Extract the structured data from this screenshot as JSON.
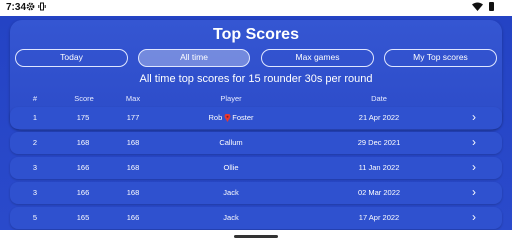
{
  "status": {
    "time": "7:34"
  },
  "title": "Top Scores",
  "tabs": [
    {
      "label": "Today",
      "active": false
    },
    {
      "label": "All time",
      "active": true
    },
    {
      "label": "Max games",
      "active": false
    },
    {
      "label": "My Top scores",
      "active": false
    }
  ],
  "subtitle": "All time top scores for 15 rounder 30s per round",
  "columns": {
    "rank": "#",
    "score": "Score",
    "max": "Max",
    "player": "Player",
    "date": "Date"
  },
  "rows": [
    {
      "rank": "1",
      "score": "175",
      "max": "177",
      "player_first": "Rob",
      "player_last": "Foster",
      "date": "21 Apr 2022"
    },
    {
      "rank": "2",
      "score": "168",
      "max": "168",
      "player": "Callum",
      "date": "29 Dec 2021"
    },
    {
      "rank": "3",
      "score": "166",
      "max": "168",
      "player": "Ollie",
      "date": "11 Jan 2022"
    },
    {
      "rank": "3",
      "score": "166",
      "max": "168",
      "player": "Jack",
      "date": "02 Mar 2022"
    },
    {
      "rank": "5",
      "score": "165",
      "max": "166",
      "player": "Jack",
      "date": "17 Apr 2022"
    }
  ],
  "colors": {
    "background": "#2443c4",
    "panel": "#3556d2",
    "row": "#2f51cf",
    "text": "#ffffff"
  },
  "icons": {
    "row_action": "chevron-right-icon",
    "player_marker": "map-pin-icon"
  }
}
